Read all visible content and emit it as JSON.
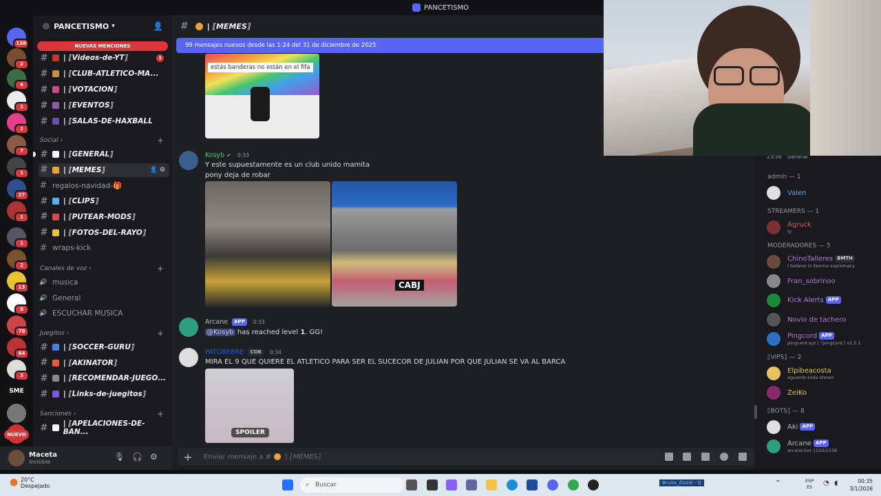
{
  "window": {
    "title": "PANCETISMO"
  },
  "server": {
    "name": "PANCETISMO",
    "mentions_banner": "NUEVAS MENCIONES",
    "new_badge": "NUEVO"
  },
  "rail_badges": [
    "138",
    "2",
    "4",
    "1",
    "1",
    "7",
    "1",
    "27",
    "1",
    "1",
    "2",
    "13",
    "8",
    "70",
    "64",
    "3",
    "SME"
  ],
  "channels": [
    {
      "name": "| ⟦Videos-de-YT⟧",
      "badge": "1"
    },
    {
      "name": "| ⟦CLUB-ATLETICO-MA...",
      "badge": ""
    },
    {
      "name": "| ⟦VOTACION⟧",
      "badge": ""
    },
    {
      "name": "| ⟦EVENTOS⟧",
      "badge": ""
    },
    {
      "name": "| ⟦SALAS-DE-HAXBALL",
      "badge": ""
    }
  ],
  "categories": {
    "social": "Social",
    "voice": "Canales de voz",
    "games": "Juegitos",
    "sanctions": "Sanciones"
  },
  "social_channels": [
    "| ⟦GENERAL⟧",
    "| ⟦MEMES⟧",
    "regalos-navidad-🎁",
    "| ⟦CLIPS⟧",
    "| ⟦PUTEAR-MODS⟧",
    "| ⟦FOTOS-DEL-RAYO⟧",
    "wraps-kick"
  ],
  "voice_channels": [
    "musica",
    "General",
    "ESCUCHAR MUSICA"
  ],
  "game_channels": [
    "| ⟦SOCCER-GURU⟧",
    "| ⟦AKINATOR⟧",
    "| ⟦RECOMENDAR-JUEGO...",
    "| ⟦Links-de-juegitos⟧"
  ],
  "sanction_channels": [
    "| ⟦APELACIONES-DE-BAN..."
  ],
  "user": {
    "name": "Maceta",
    "status": "Invisible"
  },
  "chat": {
    "channel": "| ⟦MEMES⟧",
    "new_messages": "99 mensajes nuevos desde las 1:24 del 31 de diciembre de 2025",
    "img_caption": "estás banderas no están en el fifa",
    "messages": [
      {
        "author": "Kosyb",
        "time": "0:33",
        "line1": "Y este supuestamente es un club unido mamita",
        "line2": "pony deja de robar",
        "overlay": "CABJ"
      },
      {
        "author": "Arcane",
        "tag": "APP",
        "time": "0:33",
        "mention": "@Kosyb",
        "text": "has reached level",
        "level": "1",
        "end": ". GG!"
      },
      {
        "author": "PATOBRBRE",
        "tag": "COB",
        "time": "0:34",
        "text": "MIRA EL 9 QUE QUIERE EL ATLETICO PARA SER EL SUCECOR DE JULIAN POR QUE JULIAN SE VA AL BARCA",
        "spoiler": "SPOILER"
      }
    ],
    "input_placeholder": "Enviar mensaje a #",
    "input_channel": "| ⟦MEMES⟧"
  },
  "members": {
    "top_peek": "23:56",
    "top_peek2": "General",
    "groups": [
      {
        "title": "admin — 1",
        "items": [
          {
            "name": "Valen",
            "color": "#5da8f0",
            "sub": ""
          }
        ]
      },
      {
        "title": "STREAMERS — 1",
        "items": [
          {
            "name": "Agruck",
            "color": "#e0584f",
            "sub": "ty"
          }
        ]
      },
      {
        "title": "MODERADORES — 5",
        "items": [
          {
            "name": "ChinoTalleres",
            "color": "#b07cd8",
            "sub": "I believe in Kenma supremacy",
            "tag": "BMTH"
          },
          {
            "name": "Fran_sobrinoo",
            "color": "#b07cd8",
            "sub": ""
          },
          {
            "name": "Kick Alerts",
            "color": "#b07cd8",
            "sub": "",
            "tag": "APP"
          },
          {
            "name": "Novio de tachero",
            "color": "#b07cd8",
            "sub": ""
          },
          {
            "name": "Pingcord",
            "color": "#b07cd8",
            "sub": "pingcord.xyz | ?pingcord | v2.2.1",
            "tag": "APP"
          }
        ]
      },
      {
        "title": "⟦VIPS⟧ — 2",
        "items": [
          {
            "name": "Elpibeacosta",
            "color": "#e9c04b",
            "sub": "aguante soda stereo"
          },
          {
            "name": "ZeiKo",
            "color": "#e9c04b",
            "sub": ""
          }
        ]
      },
      {
        "title": "⟦BOTS⟧ — 8",
        "items": [
          {
            "name": "Aki",
            "color": "#b5bac1",
            "sub": "",
            "tag": "APP"
          },
          {
            "name": "Arcane",
            "color": "#b5bac1",
            "sub": "arcane.bot 1520/1536",
            "tag": "APP"
          }
        ]
      }
    ]
  },
  "taskbar": {
    "weather_temp": "20°C",
    "weather_desc": "Despejado",
    "search": "Buscar",
    "stream_tag": "Bruno_Ziun0 - Q",
    "lang1": "ESP",
    "lang2": "ES",
    "time": "00:35",
    "date": "3/1/2026"
  }
}
